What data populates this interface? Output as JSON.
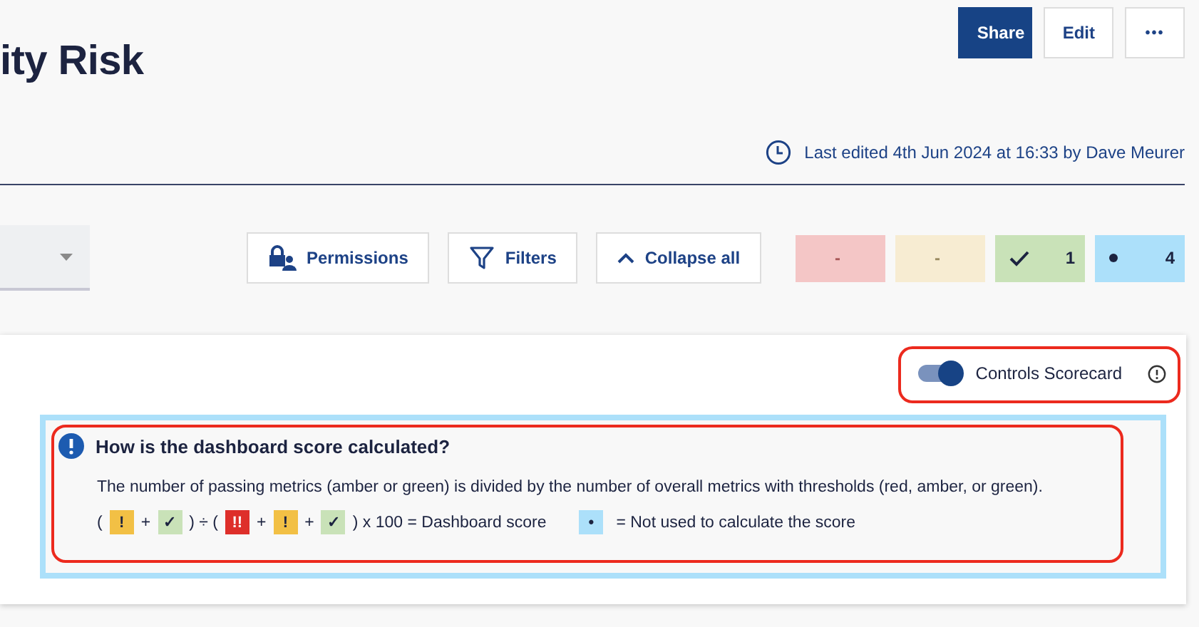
{
  "page_title": "ity Risk",
  "header_buttons": [
    {
      "kind": "primary",
      "label": "Share"
    },
    {
      "kind": "plain",
      "label": "Edit"
    },
    {
      "kind": "more",
      "label": "•••"
    }
  ],
  "last_edited": "Last edited 4th Jun 2024 at 16:33 by Dave Meurer",
  "toolbar": {
    "buttons": [
      {
        "kind": "lock",
        "label": "Permissions"
      },
      {
        "kind": "filter",
        "label": "Filters"
      },
      {
        "kind": "chevron",
        "label": "Collapse all"
      }
    ]
  },
  "status_tiles": [
    {
      "kind": "red",
      "label": "-"
    },
    {
      "kind": "amber",
      "label": "-"
    },
    {
      "kind": "green",
      "label": "1"
    },
    {
      "kind": "blue",
      "label": "4"
    }
  ],
  "scorecard_toggle": {
    "label": "Controls Scorecard",
    "on": true
  },
  "info": {
    "title": "How is the dashboard score calculated?",
    "description": "The number of passing metrics (amber or green) is divided by the number of overall metrics with thresholds (red, amber, or green).",
    "formula": [
      {
        "kind": "text",
        "text": "("
      },
      {
        "kind": "amber",
        "text": "!"
      },
      {
        "kind": "text",
        "text": "+"
      },
      {
        "kind": "green",
        "text": "✓"
      },
      {
        "kind": "text",
        "text": ") ÷ ("
      },
      {
        "kind": "red",
        "text": "!!"
      },
      {
        "kind": "text",
        "text": "+"
      },
      {
        "kind": "amber",
        "text": "!"
      },
      {
        "kind": "text",
        "text": "+"
      },
      {
        "kind": "green",
        "text": "✓"
      },
      {
        "kind": "text",
        "text": ") x 100 = Dashboard score"
      },
      {
        "kind": "blue",
        "text": "•"
      },
      {
        "kind": "text",
        "text": "= Not used to calculate the score"
      }
    ]
  }
}
